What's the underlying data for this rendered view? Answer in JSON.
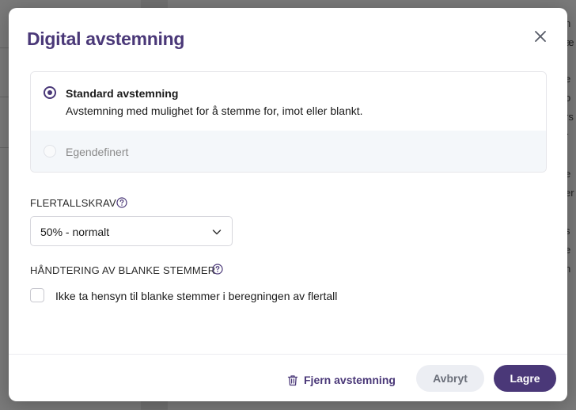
{
  "background": {
    "text_fragments": [
      "n",
      "æ",
      "",
      "e",
      "o",
      "rs",
      "r",
      "",
      "e",
      "er",
      "",
      "s",
      "e",
      "n"
    ]
  },
  "modal": {
    "title": "Digital avstemning",
    "close_icon": "close-icon",
    "vote_types": [
      {
        "title": "Standard avstemning",
        "description": "Avstemning med mulighet for å stemme for, imot eller blankt.",
        "selected": true,
        "disabled": false
      },
      {
        "title": "Egendefinert",
        "selected": false,
        "disabled": true
      }
    ],
    "majority": {
      "label": "FLERTALLSKRAV",
      "help_icon": "help-circle-icon",
      "selected_value": "50% - normalt"
    },
    "blank_votes": {
      "label": "HÅNDTERING AV BLANKE STEMMER",
      "help_icon": "help-circle-icon",
      "checkbox_label": "Ikke ta hensyn til blanke stemmer i beregningen av flertall",
      "checked": false
    },
    "footer": {
      "remove_label": "Fjern avstemning",
      "remove_icon": "trash-icon",
      "cancel_label": "Avbryt",
      "save_label": "Lagre"
    }
  },
  "colors": {
    "accent": "#4a3878",
    "cancel_bg": "#eceef3",
    "custom_option_bg": "#f4f7fa"
  }
}
